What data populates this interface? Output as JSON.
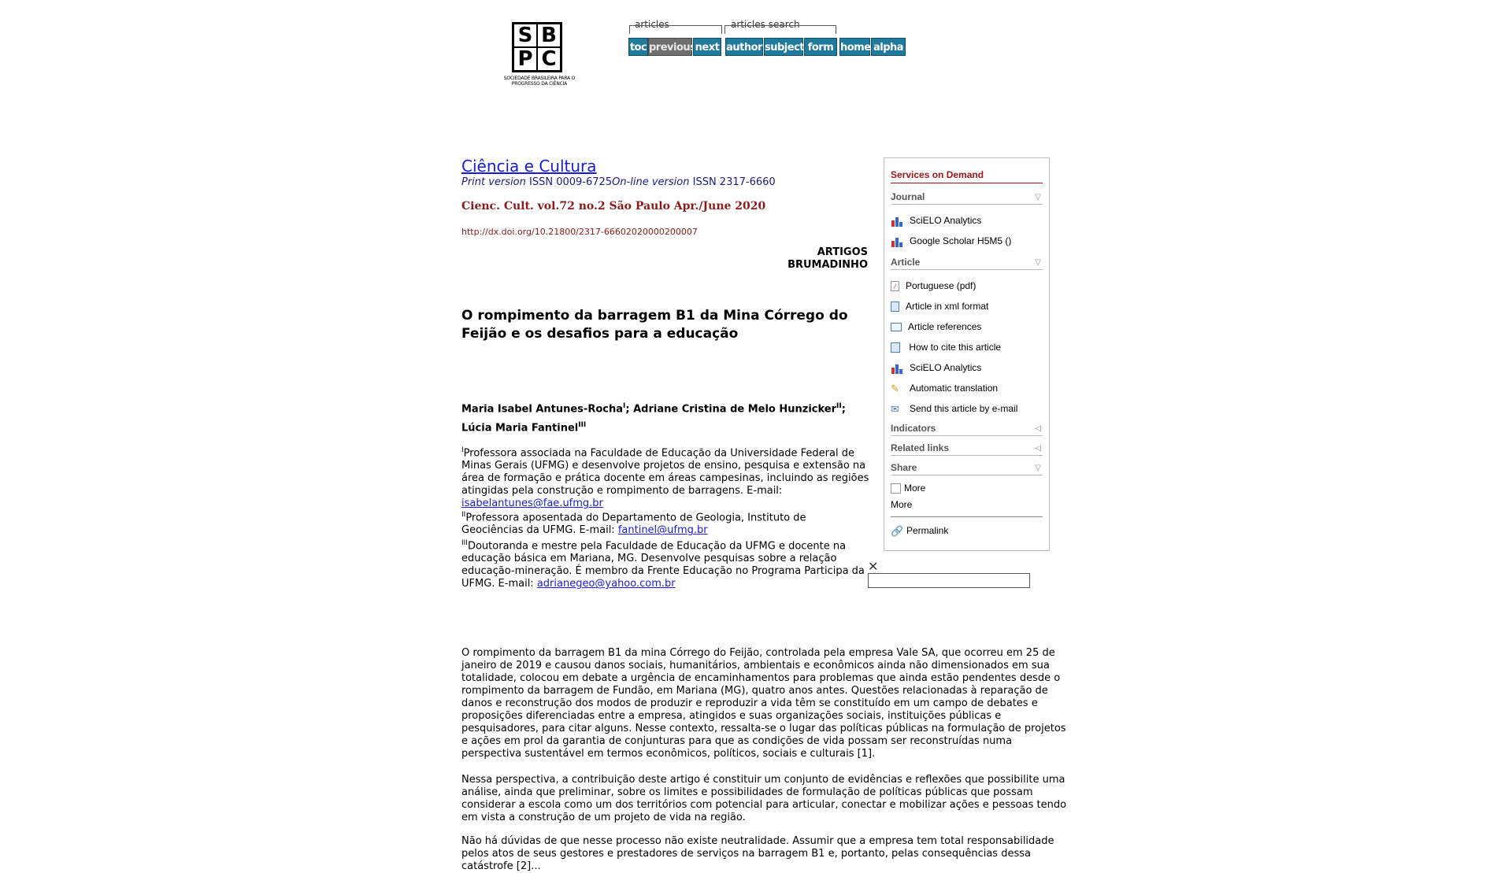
{
  "logo": {
    "letters": [
      "S",
      "B",
      "P",
      "C"
    ],
    "caption": "SOCIEDADE BRASILEIRA PARA O PROGRESSO DA CIÊNCIA"
  },
  "nav": {
    "articles_label": "articles",
    "search_label": "articles search",
    "buttons": [
      "toc",
      "previous",
      "next",
      "author",
      "subject",
      "form",
      "home",
      "alpha"
    ]
  },
  "journal": {
    "title": "Ciência e Cultura",
    "print_label": "Print version",
    "print_issn": "ISSN 0009-6725",
    "online_label": "On-line version",
    "online_issn": "ISSN 2317-6660",
    "issue": "Cienc. Cult. vol.72 no.2 São Paulo Apr./June 2020",
    "doi": "http://dx.doi.org/10.21800/2317-66602020000200007"
  },
  "section": {
    "line1": "ARTIGOS",
    "line2": "BRUMADINHO"
  },
  "article": {
    "title": "O rompimento da barragem B1 da Mina Córrego do Feijão e os desafios para a educação",
    "authors": [
      {
        "name": "Maria Isabel Antunes-Rocha",
        "mark": "I"
      },
      {
        "name": "Adriane Cristina de Melo Hunzicker",
        "mark": "II"
      },
      {
        "name": "Lúcia Maria Fantinel",
        "mark": "III"
      }
    ],
    "affiliations": [
      {
        "mark": "I",
        "text": "Professora associada na Faculdade de Educação da Universidade Federal de Minas Gerais (UFMG) e desenvolve projetos de ensino, pesquisa e extensão na área de formação e prática docente em áreas campesinas, incluindo as regiões atingidas pela construção e rompimento de barragens. E-mail: ",
        "email": "isabelantunes@fae.ufmg.br"
      },
      {
        "mark": "II",
        "text": "Professora aposentada do Departamento de Geologia, Instituto de Geociências da UFMG. E-mail: ",
        "email": "fantinel@ufmg.br"
      },
      {
        "mark": "III",
        "text": "Doutoranda e mestre pela Faculdade de Educação da UFMG e docente na educação básica em Mariana, MG. Desenvolve pesquisas sobre a relação educação-mineração. É membro da Frente Educação no Programa Participa da UFMG. E-mail: ",
        "email": "adrianegeo@yahoo.com.br"
      }
    ],
    "paragraphs": [
      "O rompimento da barragem B1 da mina Córrego do Feijão, controlada pela empresa Vale SA, que ocorreu em 25 de janeiro de 2019 e causou danos sociais, humanitários, ambientais e econômicos ainda não dimensionados em sua totalidade, colocou em debate a urgência de encaminhamentos para problemas que ainda estão pendentes desde o rompimento da barragem de Fundão, em Mariana (MG), quatro anos antes. Questões relacionadas à reparação de danos e reconstrução dos modos de produzir e reproduzir a vida têm se constituído em um campo de debates e proposições diferenciadas entre a empresa, atingidos e suas organizações sociais, instituições públicas e pesquisadores, para citar alguns. Nesse contexto, ressalta-se o lugar das políticas públicas na formulação de projetos e ações em prol da garantia de conjunturas para que as condições de vida possam ser reconstruídas numa perspectiva sustentável em termos econômicos, políticos, sociais e culturais [1].",
      "Nessa perspectiva, a contribuição deste artigo é constituir um conjunto de evidências e reflexões que possibilite uma análise, ainda que preliminar, sobre os limites e possibilidades de formulação de políticas públicas que possam considerar a escola como um dos territórios com potencial para articular, conectar e mobilizar ações e pessoas tendo em vista a construção de um projeto de vida na região.",
      "Não há dúvidas de que nesse processo não existe neutralidade. Assumir que a empresa tem total responsabilidade pelos atos de seus gestores e prestadores de serviços na barragem B1 e, portanto, pelas consequências dessa catástrofe [2]..."
    ]
  },
  "services": {
    "title": "Services on Demand",
    "journal_label": "Journal",
    "journal_items": [
      "SciELO Analytics",
      "Google Scholar H5M5 ()"
    ],
    "article_label": "Article",
    "article_items": [
      "Portuguese (pdf)",
      "Article in xml format",
      "Article references",
      "How to cite this article",
      "SciELO Analytics",
      "Automatic translation",
      "Send this article by e-mail"
    ],
    "indicators_label": "Indicators",
    "related_label": "Related links",
    "share_label": "Share",
    "more1": "More",
    "more2": "More",
    "permalink": "Permalink"
  }
}
